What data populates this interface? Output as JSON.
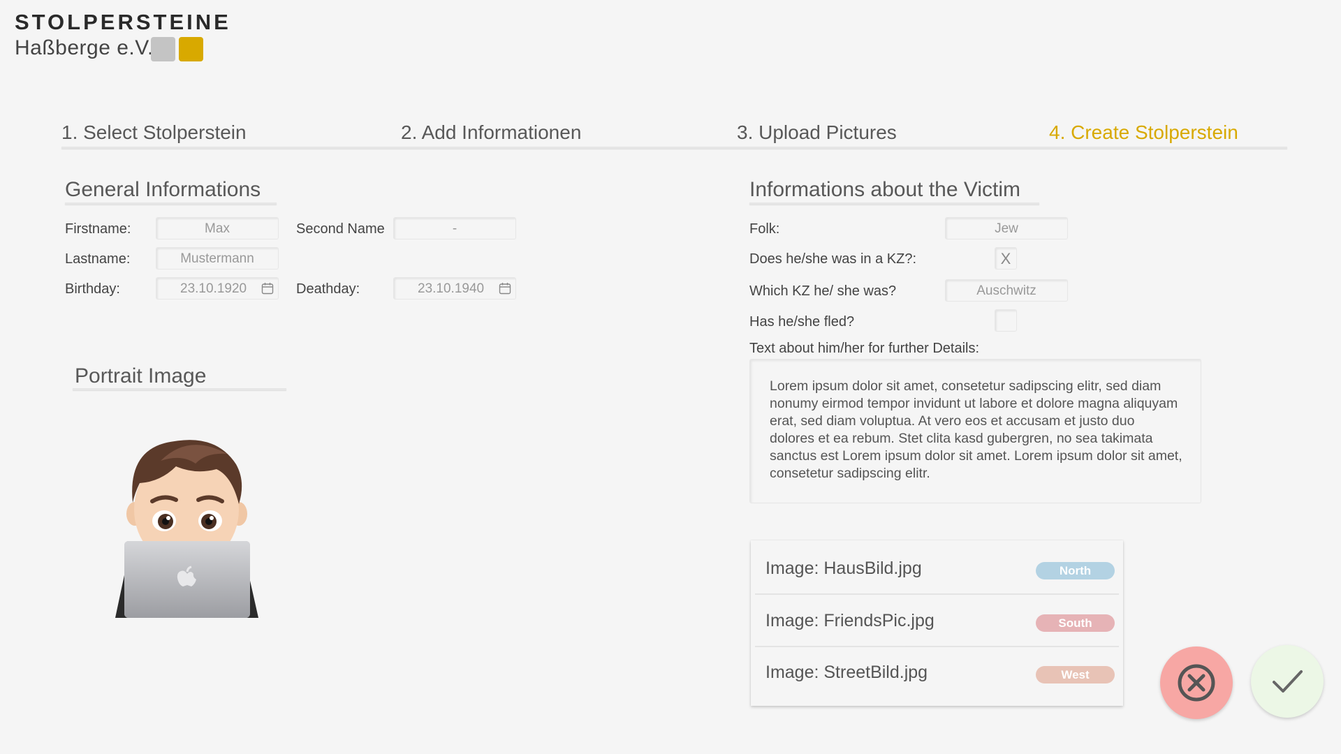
{
  "logo": {
    "title": "STOLPERSTEINE",
    "subtitle": "Haßberge e.V."
  },
  "colors": {
    "accent": "#d8a900",
    "north": "#b3d2e3",
    "south": "#e6b3b6",
    "west": "#e8c3b6",
    "cancel": "#f7a7a4",
    "confirm": "#ecf7e6"
  },
  "steps": [
    {
      "label": "1. Select Stolperstein",
      "active": false
    },
    {
      "label": "2. Add Informationen",
      "active": false
    },
    {
      "label": "3. Upload Pictures",
      "active": false
    },
    {
      "label": "4. Create Stolperstein",
      "active": true
    }
  ],
  "general": {
    "title": "General Informations",
    "firstname_label": "Firstname:",
    "firstname_value": "Max",
    "second_name_label": "Second Name",
    "second_name_value": "-",
    "lastname_label": "Lastname:",
    "lastname_value": "Mustermann",
    "birthday_label": "Birthday:",
    "birthday_value": "23.10.1920",
    "deathday_label": "Deathday:",
    "deathday_value": "23.10.1940"
  },
  "portrait": {
    "title": "Portrait Image",
    "icon": "memoji-avatar-with-laptop"
  },
  "victim": {
    "title": "Informations about the Victim",
    "folk_label": "Folk:",
    "folk_value": "Jew",
    "kz_label": "Does he/she was in a KZ?:",
    "kz_checked": "X",
    "which_kz_label": "Which KZ he/ she was?",
    "which_kz_value": "Auschwitz",
    "fled_label": "Has he/she fled?",
    "fled_checked": "",
    "details_label": "Text about him/her for further Details:",
    "details_text": "Lorem ipsum dolor sit amet, consetetur sadipscing elitr, sed diam nonumy eirmod tempor invidunt ut labore et dolore magna aliquyam erat, sed diam voluptua. At vero eos et accusam et justo duo dolores et ea rebum. Stet clita kasd gubergren, no sea takimata sanctus est Lorem ipsum dolor sit amet. Lorem ipsum dolor sit amet, consetetur sadipscing elitr."
  },
  "images": [
    {
      "label": "Image: HausBild.jpg",
      "tag": "North"
    },
    {
      "label": "Image: FriendsPic.jpg",
      "tag": "South"
    },
    {
      "label": "Image: StreetBild.jpg",
      "tag": "West"
    }
  ],
  "actions": {
    "cancel_icon": "circle-x-icon",
    "confirm_icon": "checkmark-icon"
  }
}
